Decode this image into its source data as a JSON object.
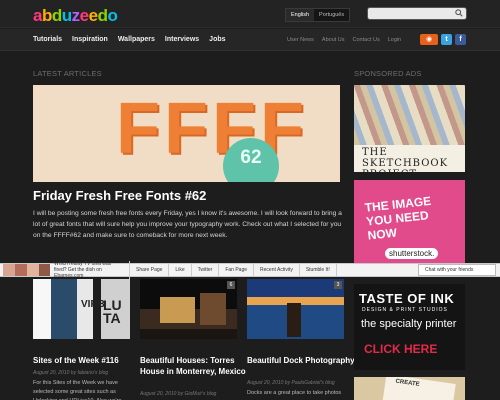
{
  "header": {
    "logo": "abduzeedo",
    "languages": [
      "English",
      "Português"
    ],
    "search": {
      "placeholder": ""
    }
  },
  "nav": {
    "main": [
      "Tutorials",
      "Inspiration",
      "Wallpapers",
      "Interviews",
      "Jobs"
    ],
    "utility": [
      "User News",
      "About Us",
      "Contact Us",
      "Login"
    ],
    "social": {
      "rss": "rss-icon",
      "twitter": "twitter-icon",
      "facebook": "facebook-icon"
    }
  },
  "latest": {
    "label": "LATEST ARTICLES",
    "hero": {
      "image_text": "FFFF",
      "badge": "62",
      "title": "Friday Fresh Free Fonts #62",
      "excerpt": "I will be posting some fresh free fonts every Friday, yes I know it's awesome. I will look forward to bring a lot of great fonts that will sure help you improve your typography work. Check out what I selected for you on the FFFF#62 and make sure to comeback for more next week."
    },
    "cards": [
      {
        "num": "",
        "title": "Sites of the Week #116",
        "meta": "August 20, 2010 by fabiano's blog",
        "excerpt": "For this Sites of the Week we have selected some great sites such as Unlocking and HDLive10. Also we're"
      },
      {
        "num": "6",
        "title": "Beautiful Houses: Torres House in Monterrey, Mexico",
        "meta": "August 20, 2010 by GioMuir's blog",
        "excerpt": ""
      },
      {
        "num": "3",
        "title": "Beautiful Dock Photography",
        "meta": "August 20, 2010 by PauloGabriel's blog",
        "excerpt": "Docks are a great place to take photos"
      }
    ]
  },
  "sponsored": {
    "label": "SPONSORED ADS",
    "ads": [
      {
        "line1": "THE SKETCHBOOK PROJECT",
        "line2": ""
      },
      {
        "line1": "THE IMAGE YOU NEED NOW",
        "line2": "shutterstock."
      },
      {
        "line1": "TASTE OF INK",
        "line2": "DESIGN & PRINT STUDIOS",
        "line3": "the specialty printer",
        "line4": "CLICK HERE"
      },
      {
        "line1": "CREATE"
      }
    ]
  },
  "fb_toolbar": {
    "question": "Which reality TV diva was fired? Get the dish on Ebarnes.com",
    "items": [
      "Share Page",
      "Like",
      "Twitter",
      "Fan Page",
      "Recent Activity",
      "Stumble It!"
    ],
    "chat": "Chat with your friends"
  },
  "colors": {
    "bg": "#1d1d1d",
    "accent_orange": "#ef7f35",
    "badge_green": "#5ec3a8",
    "ad_pink": "#e14a8b",
    "ad_red": "#e32a48"
  }
}
